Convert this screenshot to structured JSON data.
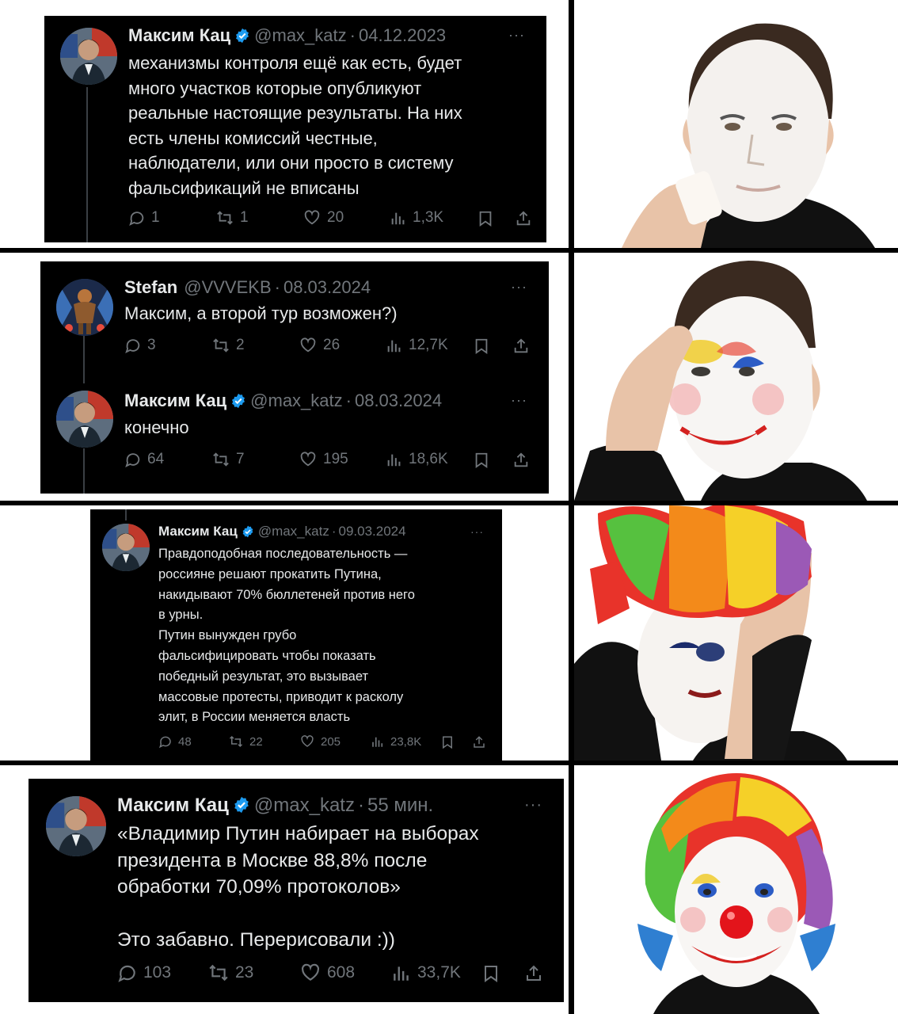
{
  "colors": {
    "panel_bg": "#000000",
    "text": "#e7e9ea",
    "muted": "#71767b",
    "verified": "#1d9bf0"
  },
  "panels": [
    {
      "tweets": [
        {
          "name": "Максим Кац",
          "handle": "@max_katz",
          "date": "04.12.2023",
          "verified": true,
          "text": "механизмы контроля ещё как есть, будет\nмного участков которые опубликуют\nреальные настоящие результаты. На них\nесть члены комиссий честные,\nнаблюдатели, или они просто в систему\nфальсификаций не вписаны",
          "replies": "1",
          "reposts": "1",
          "likes": "20",
          "views": "1,3K"
        }
      ]
    },
    {
      "tweets": [
        {
          "name": "Stefan",
          "handle": "@VVVEKB",
          "date": "08.03.2024",
          "verified": false,
          "text": "Максим, а второй тур возможен?)",
          "replies": "3",
          "reposts": "2",
          "likes": "26",
          "views": "12,7K"
        },
        {
          "name": "Максим Кац",
          "handle": "@max_katz",
          "date": "08.03.2024",
          "verified": true,
          "text": "конечно",
          "replies": "64",
          "reposts": "7",
          "likes": "195",
          "views": "18,6K"
        }
      ]
    },
    {
      "tweets": [
        {
          "name": "Максим Кац",
          "handle": "@max_katz",
          "date": "09.03.2024",
          "verified": true,
          "text": "Правдоподобная последовательность —\nроссияне решают прокатить Путина,\nнакидывают 70% бюллетеней против него\nв урны.\nПутин вынужден грубо\nфальсифицировать чтобы показать\nпобедный результат, это вызывает\nмассовые протесты, приводит к расколу\nэлит, в России меняется власть",
          "replies": "48",
          "reposts": "22",
          "likes": "205",
          "views": "23,8K"
        }
      ]
    },
    {
      "tweets": [
        {
          "name": "Максим Кац",
          "handle": "@max_katz",
          "date": "55 мин.",
          "verified": true,
          "text": "«Владимир Путин набирает на выборах\nпрезидента в Москве 88,8% после\nобработки 70,09% протоколов»\n\nЭто забавно. Перерисовали :))",
          "replies": "103",
          "reposts": "23",
          "likes": "608",
          "views": "33,7K"
        }
      ]
    }
  ],
  "sep": "·",
  "more": "···",
  "icons": [
    "reply-icon",
    "repost-icon",
    "like-icon",
    "views-icon",
    "bookmark-icon",
    "share-icon"
  ],
  "faces": [
    "face-white-makeup",
    "face-clown-paint",
    "face-clown-wig",
    "face-full-clown"
  ]
}
